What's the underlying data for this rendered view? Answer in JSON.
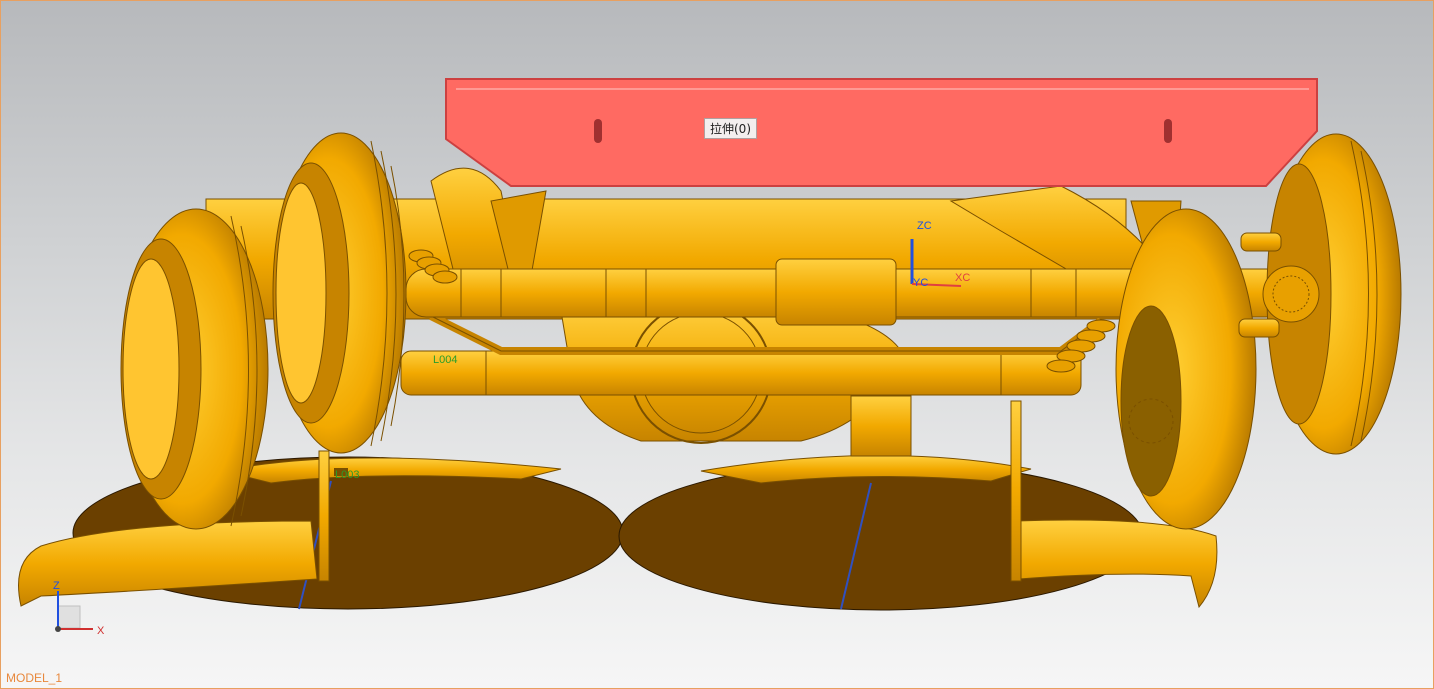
{
  "viewport": {
    "model_name": "MODEL_1",
    "feature_label": "拉伸(0)"
  },
  "annotations": {
    "label_left": "L004",
    "label_center": "L003"
  },
  "wcs": {
    "z": "ZC",
    "y": "YC",
    "x": "XC"
  },
  "triad": {
    "z": "Z",
    "x": "X"
  },
  "colors": {
    "part": "#f2a900",
    "part_dark": "#c78400",
    "highlight": "#ff6a62",
    "disk": "#6b4000",
    "background_top": "#b7b9bc",
    "background_bottom": "#f6f6f6"
  }
}
